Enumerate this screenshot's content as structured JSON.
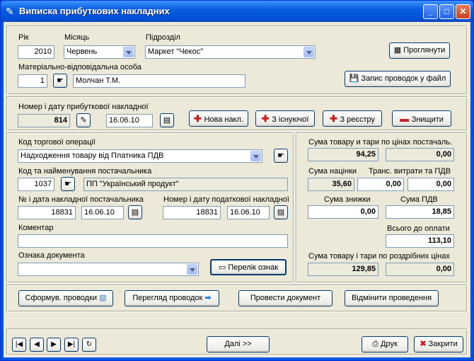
{
  "window": {
    "title": "Виписка  прибуткових накладних"
  },
  "period": {
    "year_label": "Рік",
    "year": "2010",
    "month_label": "Місяць",
    "month": "Червень",
    "division_label": "Підрозділ",
    "division": "Маркет \"Чекос\"",
    "resp_label": "Матеріально-відповідальна особа",
    "resp_code": "1",
    "resp_name": "Молчан Т.М."
  },
  "top_buttons": {
    "view": "Проглянути",
    "save": "Запис проводок у файл"
  },
  "invoice": {
    "label": "Номер і дату прибуткової накладної",
    "number": "814",
    "date": "16.06.10",
    "new": "Нова накл.",
    "from_existing": "З існуючої",
    "from_registry": "З реєстру",
    "delete": "Знищити"
  },
  "operation": {
    "label": "Код торгової операції",
    "value": "Надходження товару від Платника ПДВ"
  },
  "supplier": {
    "label": "Код та найменування постачальника",
    "code": "1037",
    "name": "ПП \"Український продукт\""
  },
  "supplier_invoice": {
    "label": "№ і дата накладної постачальника",
    "number": "18831",
    "date": "16.06.10"
  },
  "tax_invoice": {
    "label": "Номер і дату податкової накладної",
    "number": "18831",
    "date": "16.06.10"
  },
  "comment": {
    "label": "Коментар",
    "value": ""
  },
  "doc_mark": {
    "label": "Ознака документа",
    "value": "",
    "list_button": "Перелік ознак"
  },
  "sums": {
    "supplier_prices_label": "Сума товару и тари по цінах постачаль.",
    "supplier_prices_1": "94,25",
    "supplier_prices_2": "0,00",
    "markup_label": "Сума націнки",
    "markup": "35,60",
    "transport_label": "Транс. витрати та ПДВ",
    "transport_1": "0,00",
    "transport_2": "0,00",
    "discount_label": "Сума знижки",
    "discount": "0,00",
    "vat_label": "Сума ПДВ",
    "vat": "18,85",
    "total_label": "Всього до оплати",
    "total": "113,10",
    "retail_label": "Сума товару і тари по роздрібних цінах",
    "retail_1": "129,85",
    "retail_2": "0,00"
  },
  "bottom_buttons": {
    "form": "Сформув. проводки",
    "review": "Перегляд проводок",
    "post": "Провести документ",
    "cancel": "Відмінити проведення"
  },
  "footer": {
    "next": "Далі >>",
    "print": "Друк",
    "close": "Закрити"
  }
}
